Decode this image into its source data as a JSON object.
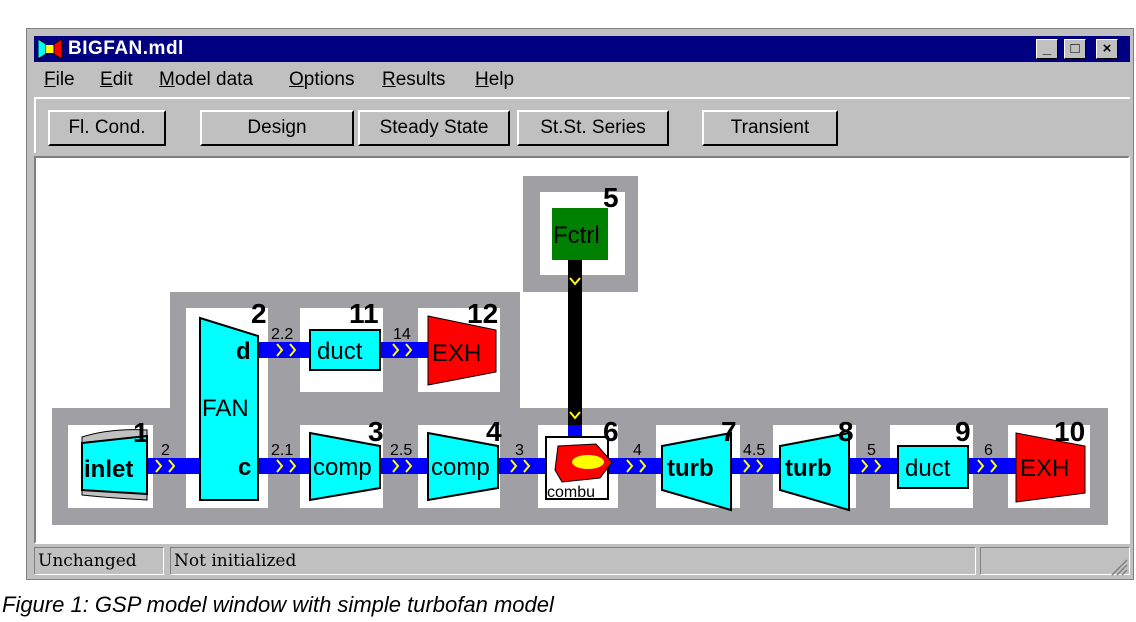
{
  "window": {
    "title": "BIGFAN.mdl",
    "controls": [
      "_",
      "□",
      "×"
    ]
  },
  "menu": [
    "File",
    "Edit",
    "Model data",
    "Options",
    "Results",
    "Help"
  ],
  "toolbar": {
    "fl_cond": "Fl. Cond.",
    "design": "Design",
    "steady_state": "Steady State",
    "stst_series": "St.St. Series",
    "transient": "Transient"
  },
  "components": {
    "inlet": {
      "num": "1",
      "label": "inlet"
    },
    "fan": {
      "num": "2",
      "label": "FAN",
      "port_d": "d",
      "port_c": "c"
    },
    "comp3": {
      "num": "3",
      "label": "comp"
    },
    "comp4": {
      "num": "4",
      "label": "comp"
    },
    "fctrl": {
      "num": "5",
      "label": "Fctrl"
    },
    "combu": {
      "num": "6",
      "label": "combu"
    },
    "turb7": {
      "num": "7",
      "label": "turb"
    },
    "turb8": {
      "num": "8",
      "label": "turb"
    },
    "duct9": {
      "num": "9",
      "label": "duct"
    },
    "exh10": {
      "num": "10",
      "label": "EXH"
    },
    "duct11": {
      "num": "11",
      "label": "duct"
    },
    "exh12": {
      "num": "12",
      "label": "EXH"
    }
  },
  "stations": {
    "s2": "2",
    "s21": "2.1",
    "s22": "2.2",
    "s14": "14",
    "s25": "2.5",
    "s3": "3",
    "s4": "4",
    "s45": "4.5",
    "s5": "5",
    "s6": "6"
  },
  "colors": {
    "component": "#00ffff",
    "exhaust": "#ff0000",
    "control": "#008000",
    "flow": "#0000ff",
    "chevron": "#ffff00",
    "region": "#a0a0a4",
    "titlebar": "#000080"
  },
  "status": {
    "left": "Unchanged",
    "middle": "Not initialized"
  },
  "caption": "Figure 1: GSP model window with simple turbofan model"
}
